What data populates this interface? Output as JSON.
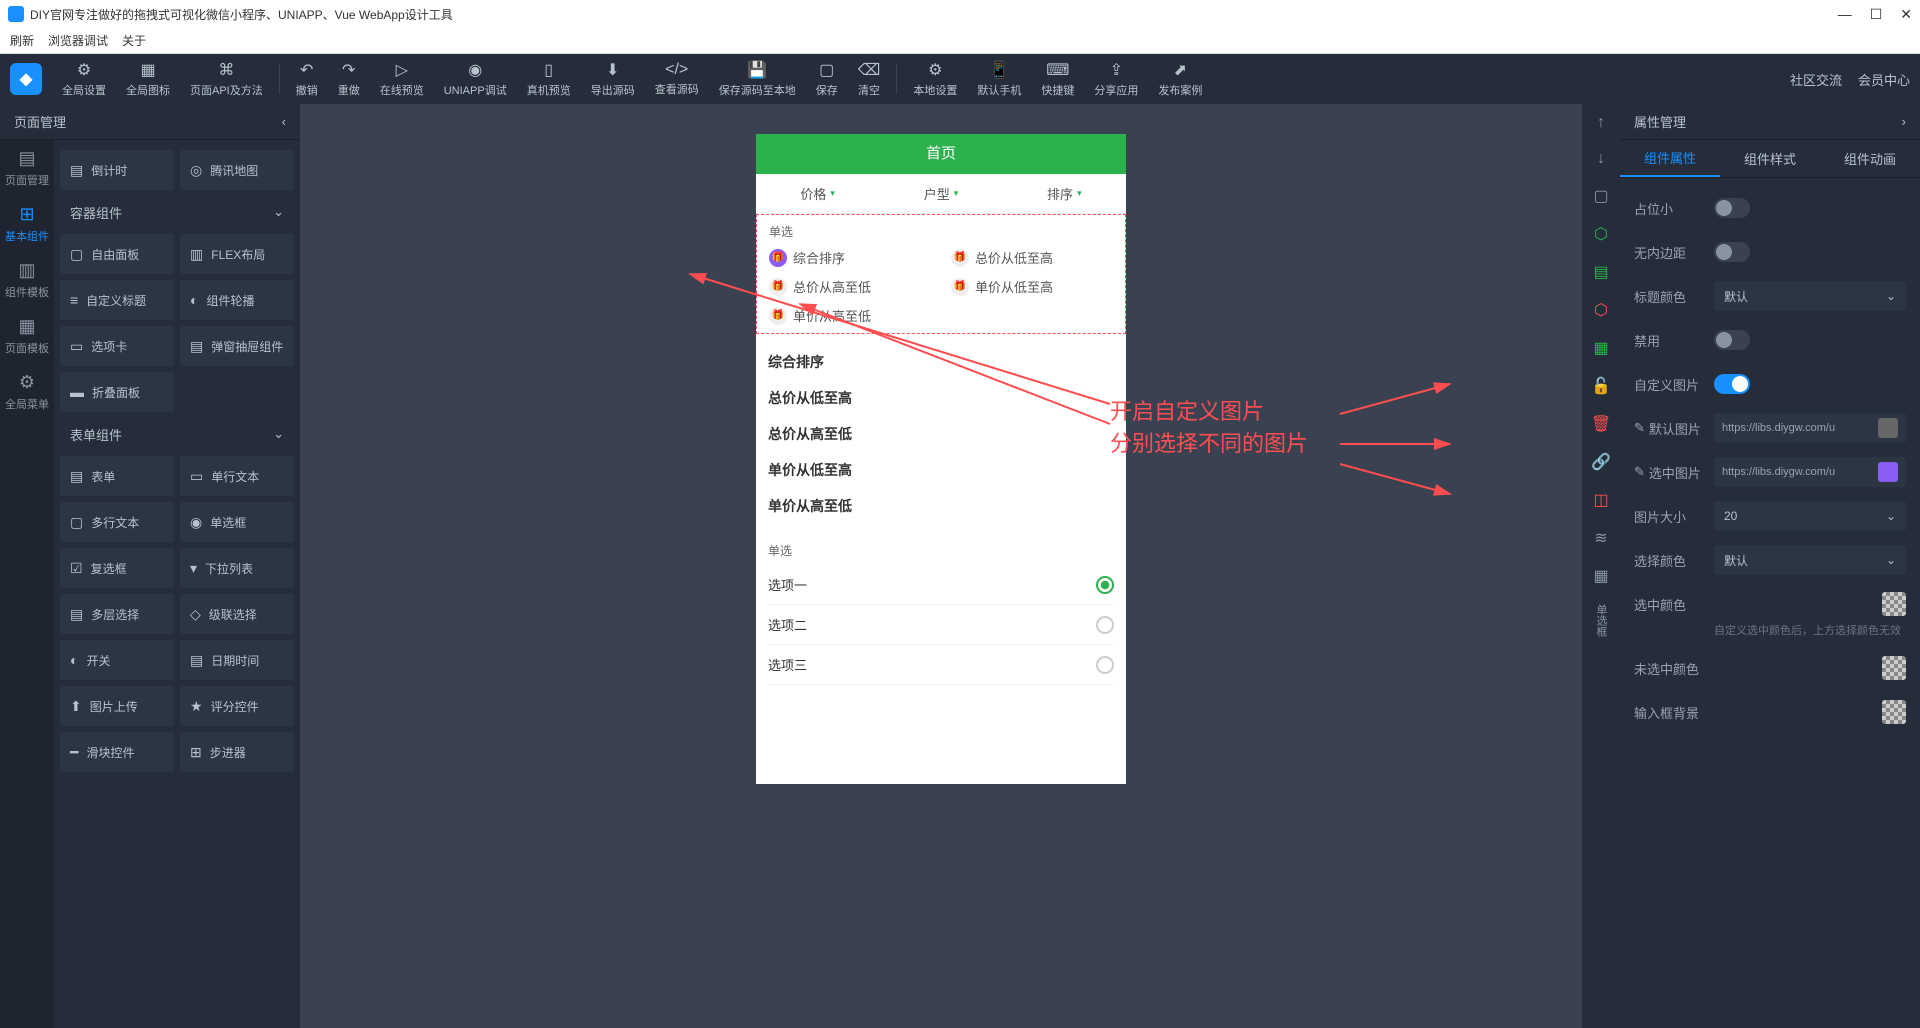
{
  "window": {
    "title": "DIY官网专注做好的拖拽式可视化微信小程序、UNIAPP、Vue WebApp设计工具"
  },
  "menubar": [
    "刷新",
    "浏览器调试",
    "关于"
  ],
  "toolbar": {
    "global_setting": "全局设置",
    "global_icon": "全局图标",
    "page_api": "页面API及方法",
    "undo": "撤销",
    "redo": "重做",
    "online_preview": "在线预览",
    "uniapp_debug": "UNIAPP调试",
    "phone_preview": "真机预览",
    "export_src": "导出源码",
    "view_src": "查看源码",
    "save_local": "保存源码至本地",
    "save": "保存",
    "clear": "清空",
    "local_setting": "本地设置",
    "default_phone": "默认手机",
    "shortcut": "快捷键",
    "share_app": "分享应用",
    "publish_case": "发布案例",
    "community": "社区交流",
    "member": "会员中心"
  },
  "left": {
    "header": "页面管理",
    "tabs": {
      "page_mgmt": "页面管理",
      "basic_comp": "基本组件",
      "comp_tpl": "组件模板",
      "page_tpl": "页面模板",
      "global_menu": "全局菜单"
    },
    "group_top": [
      "倒计时",
      "腾讯地图"
    ],
    "group_container_title": "容器组件",
    "group_container": [
      "自由面板",
      "FLEX布局",
      "自定义标题",
      "组件轮播",
      "选项卡",
      "弹窗抽屉组件",
      "折叠面板"
    ],
    "group_form_title": "表单组件",
    "group_form": [
      "表单",
      "单行文本",
      "多行文本",
      "单选框",
      "复选框",
      "下拉列表",
      "多层选择",
      "级联选择",
      "开关",
      "日期时间",
      "图片上传",
      "评分控件",
      "滑块控件",
      "步进器"
    ]
  },
  "canvas": {
    "page_title": "首页",
    "filter_tabs": [
      "价格",
      "户型",
      "排序"
    ],
    "radio_title": "单选",
    "radio_items": [
      "综合排序",
      "总价从低至高",
      "总价从高至低",
      "单价从低至高",
      "单价从高至低"
    ],
    "plain_items": [
      "综合排序",
      "总价从低至高",
      "总价从高至低",
      "单价从低至高",
      "单价从高至低"
    ],
    "radio2_title": "单选",
    "options": [
      "选项一",
      "选项二",
      "选项三"
    ],
    "annotation_line1": "开启自定义图片",
    "annotation_line2": "分别选择不同的图片"
  },
  "right": {
    "header": "属性管理",
    "tabs": [
      "组件属性",
      "组件样式",
      "组件动画"
    ],
    "strip_label": "单选框",
    "props": {
      "placeholder": "占位小",
      "no_padding": "无内边距",
      "title_color": "标题颜色",
      "title_color_val": "默认",
      "disabled": "禁用",
      "custom_img": "自定义图片",
      "default_img": "默认图片",
      "default_img_val": "https://libs.diygw.com/u",
      "selected_img": "选中图片",
      "selected_img_val": "https://libs.diygw.com/u",
      "img_size": "图片大小",
      "img_size_val": "20",
      "select_color": "选择颜色",
      "select_color_val": "默认",
      "checked_color": "选中颜色",
      "help1": "自定义选中颜色后，上方选择颜色无效",
      "unchecked_color": "未选中颜色",
      "input_bg": "输入框背景"
    }
  }
}
